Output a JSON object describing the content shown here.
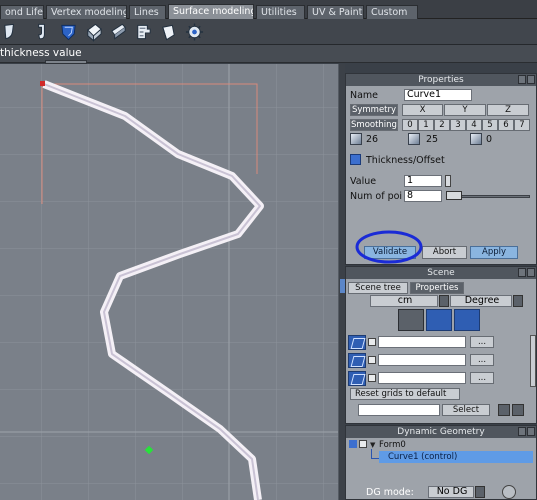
{
  "tabs": [
    {
      "label": "ond Life",
      "active": false
    },
    {
      "label": "Vertex modeling",
      "active": false
    },
    {
      "label": "Lines",
      "active": false
    },
    {
      "label": "Surface modeling",
      "active": true
    },
    {
      "label": "Utilities",
      "active": false
    },
    {
      "label": "UV & Paint",
      "active": false
    },
    {
      "label": "Custom",
      "active": false
    }
  ],
  "toolbar": {
    "icons": [
      "bent-surface-icon",
      "hook-surface-icon",
      "shield-surface-icon",
      "extrude-box-icon",
      "slice-surface-icon",
      "steps-surface-icon",
      "shell-surface-icon",
      "gear-surface-icon"
    ]
  },
  "status": {
    "text": "thickness value"
  },
  "properties": {
    "title": "Properties",
    "name_label": "Name",
    "name_value": "Curve1",
    "symmetry_label": "Symmetry",
    "symmetry_axes": [
      "X",
      "Y",
      "Z"
    ],
    "smoothing_label": "Smoothing",
    "smoothing_levels": [
      "0",
      "1",
      "2",
      "3",
      "4",
      "5",
      "6",
      "7"
    ],
    "counts": [
      "26",
      "25",
      "0"
    ],
    "tool_name": "Thickness/Offset",
    "value_label": "Value",
    "value_value": "1",
    "num_points_label": "Num of poi",
    "num_points_value": "8",
    "validate_label": "Validate",
    "abort_label": "Abort",
    "apply_label": "Apply"
  },
  "scene": {
    "title": "Scene",
    "tab_scene_tree": "Scene tree",
    "tab_properties": "Properties",
    "unit_value": "cm",
    "angle_value": "Degree",
    "grid_buttons": [
      "...",
      "...",
      "..."
    ],
    "reset_label": "Reset grids to default",
    "select_label": "Select"
  },
  "dynamic_geometry": {
    "title": "Dynamic Geometry",
    "root_label": "Form0",
    "child_label": "Curve1 (control)",
    "mode_label": "DG mode:",
    "mode_value": "No DG"
  },
  "colors": {
    "accent_blue": "#1a2bd6",
    "selected_row": "#5f9be6",
    "viewport_bg": "#7a8089"
  }
}
